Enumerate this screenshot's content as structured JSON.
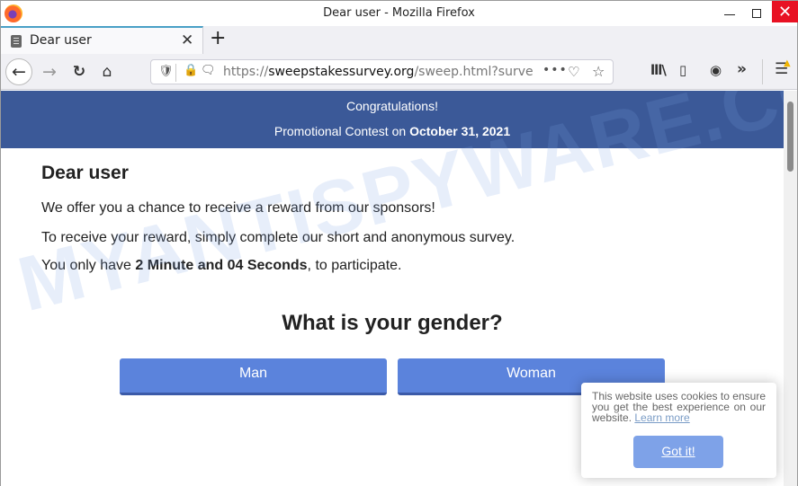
{
  "window": {
    "title": "Dear user - Mozilla Firefox",
    "controls": {
      "minimize": "minimize",
      "maximize": "maximize",
      "close": "✕"
    }
  },
  "tabs": [
    {
      "title": "Dear user",
      "active": true,
      "close_glyph": "✕"
    }
  ],
  "new_tab_glyph": "+",
  "navbar": {
    "back_glyph": "←",
    "forward_glyph": "→",
    "reload_glyph": "↻",
    "home_glyph": "⌂",
    "url": {
      "scheme": "https://",
      "host": "sweepstakessurvey.org",
      "path": "/sweep.html?surve"
    },
    "page_actions_glyph": "•••",
    "pocket_glyph": "♡",
    "bookmark_glyph": "☆",
    "toolbar": {
      "library_glyph": "lll\\",
      "sidebar_glyph": "▯",
      "extension_glyph": "◉",
      "overflow_glyph": "»",
      "menu_glyph": "☰",
      "warning_glyph": "▲"
    }
  },
  "page": {
    "banner": {
      "line1": "Congratulations!",
      "line2_prefix": "Promotional Contest on ",
      "line2_date": "October 31, 2021"
    },
    "heading": "Dear user",
    "paragraphs": {
      "p1": "We offer you a chance to receive a reward from our sponsors!",
      "p2": "To receive your reward, simply complete our short and anonymous survey.",
      "p3_prefix": "You only have ",
      "p3_time": "2 Minute and 04 Seconds",
      "p3_suffix": ", to participate."
    },
    "question": "What is your gender?",
    "answers": [
      "Man",
      "Woman"
    ],
    "watermark": "MYANTISPYWARE.COM"
  },
  "cookie_notice": {
    "text": "This website uses cookies to ensure you get the best experience on our website. ",
    "link": "Learn more",
    "button": "Got it!"
  },
  "colors": {
    "banner": "#3b5998",
    "answer_button": "#5b83dc",
    "cookie_button": "#7ea2e8",
    "close_button": "#e81123"
  }
}
